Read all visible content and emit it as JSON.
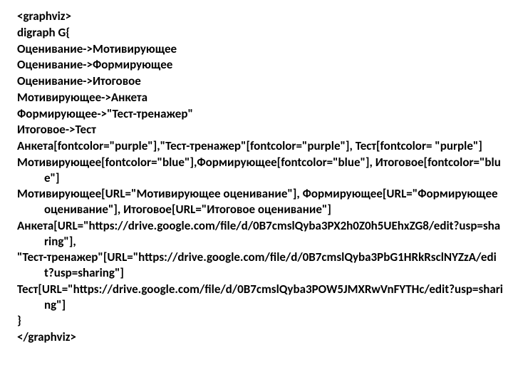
{
  "lines": [
    "<graphviz>",
    "digraph G{",
    "Оценивание->Мотивирующее",
    "Оценивание->Формирующее",
    "Оценивание->Итоговое",
    "Мотивирующее->Анкета",
    "Формирующее->\"Тест-тренажер\"",
    "Итоговое->Тест",
    "Анкета[fontcolor=\"purple\"],\"Тест-тренажер\"[fontcolor=\"purple\"], Тест[fontcolor= \"purple\"]",
    "Мотивирующее[fontcolor=\"blue\"],Формирующее[fontcolor=\"blue\"], Итоговое[fontcolor=\"blue\"]",
    "Мотивирующее[URL=\"Мотивирующее оценивание\"], Формирующее[URL=\"Формирующее оценивание\"], Итоговое[URL=\"Итоговое оценивание\"]",
    "Анкета[URL=\"https://drive.google.com/file/d/0B7cmslQyba3PX2h0Z0h5UEhxZG8/edit?usp=sharing\"],",
    "\"Тест-тренажер\"[URL=\"https://drive.google.com/file/d/0B7cmslQyba3PbG1HRkRsclNYZzA/edit?usp=sharing\"]",
    "Тест[URL=\"https://drive.google.com/file/d/0B7cmslQyba3POW5JMXRwVnFYTHc/edit?usp=sharing\"]",
    "}",
    "</graphviz>"
  ]
}
